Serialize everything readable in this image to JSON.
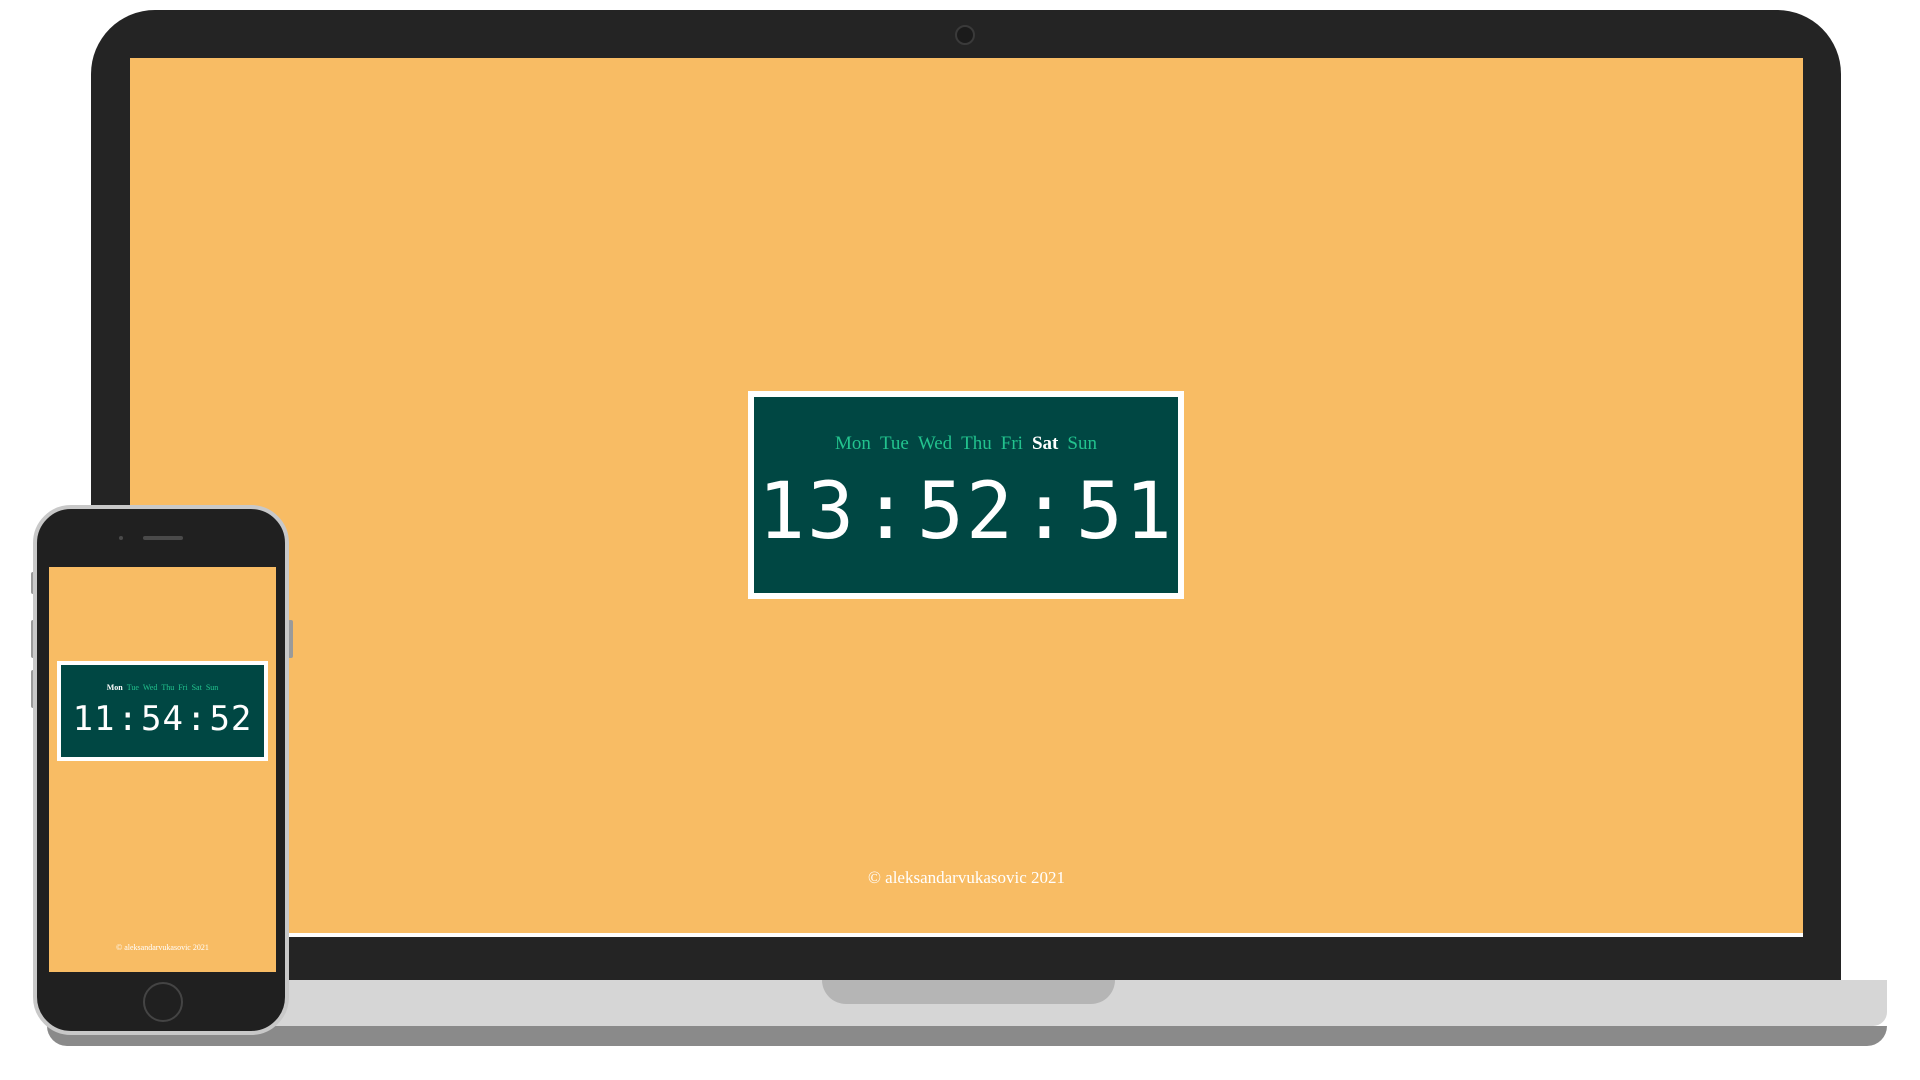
{
  "laptop": {
    "days": [
      "Mon",
      "Tue",
      "Wed",
      "Thu",
      "Fri",
      "Sat",
      "Sun"
    ],
    "active_day": "Sat",
    "time": {
      "hours": "13",
      "minutes": "52",
      "seconds": "51",
      "separator": ":"
    },
    "footer": "© aleksandarvukasovic 2021"
  },
  "phone": {
    "days": [
      "Mon",
      "Tue",
      "Wed",
      "Thu",
      "Fri",
      "Sat",
      "Sun"
    ],
    "active_day": "Mon",
    "time": {
      "hours": "11",
      "minutes": "54",
      "seconds": "52",
      "separator": ":"
    },
    "footer": "© aleksandarvukasovic 2021"
  },
  "colors": {
    "background": "#f8bc64",
    "clock_panel": "#004743",
    "day_inactive": "#22c38e",
    "day_active": "#ffffff"
  }
}
